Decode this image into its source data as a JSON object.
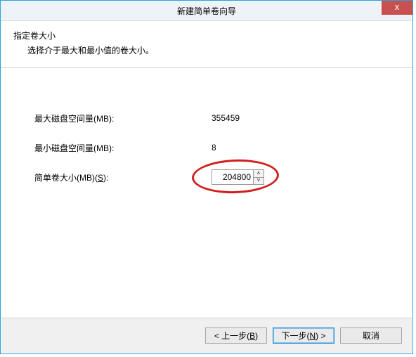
{
  "titlebar": {
    "title": "新建简单卷向导",
    "close_glyph": "x"
  },
  "header": {
    "title": "指定卷大小",
    "subtitle": "选择介于最大和最小值的卷大小。"
  },
  "fields": {
    "max_label": "最大磁盘空间量(MB):",
    "max_value": "355459",
    "min_label": "最小磁盘空间量(MB):",
    "min_value": "8",
    "size_label_pre": "简单卷大小(MB)(",
    "size_label_hot": "S",
    "size_label_post": "):",
    "size_value": "204800"
  },
  "buttons": {
    "back_pre": "< 上一步(",
    "back_hot": "B",
    "back_post": ")",
    "next_pre": "下一步(",
    "next_hot": "N",
    "next_post": ") >",
    "cancel": "取消"
  },
  "spinner": {
    "up": "˄",
    "down": "˅"
  }
}
